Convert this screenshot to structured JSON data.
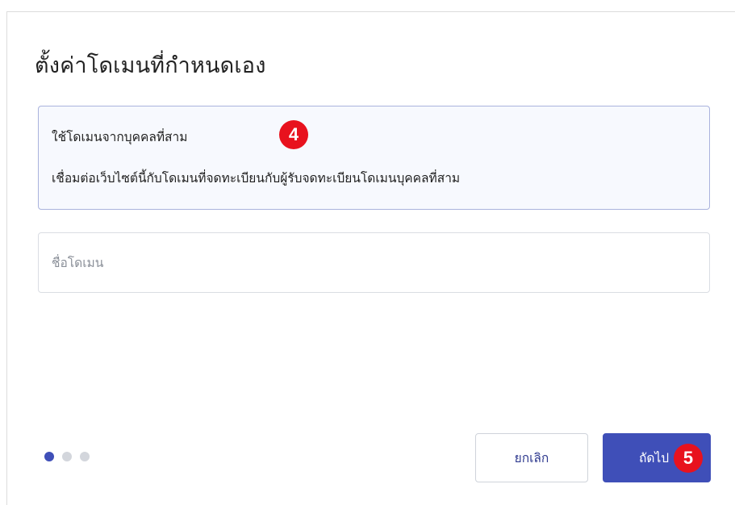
{
  "dialog": {
    "title": "ตั้งค่าโดเมนที่กำหนดเอง"
  },
  "option": {
    "title": "ใช้โดเมนจากบุคคลที่สาม",
    "description": "เชื่อมต่อเว็บไซต์นี้กับโดเมนที่จดทะเบียนกับผู้รับจดทะเบียนโดเมนบุคคลที่สาม"
  },
  "domain_input": {
    "placeholder": "ชื่อโดเมน",
    "value": ""
  },
  "steps": {
    "total": 3,
    "current": 1
  },
  "buttons": {
    "cancel_label": "ยกเลิก",
    "next_label": "ถัดไป"
  },
  "annotations": {
    "badge_a": "4",
    "badge_b": "5"
  },
  "colors": {
    "accent": "#3f4fb8",
    "badge": "#e8121e",
    "card_border": "#aab3dd"
  }
}
